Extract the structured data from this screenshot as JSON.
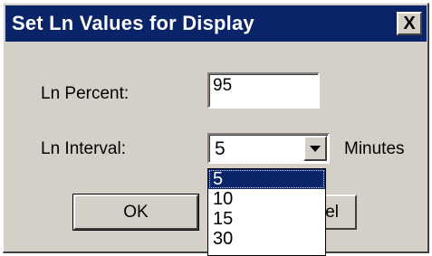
{
  "dialog": {
    "title": "Set Ln Values for Display",
    "close_label": "X"
  },
  "form": {
    "ln_percent_label": "Ln Percent:",
    "ln_percent_value": "95",
    "ln_interval_label": "Ln Interval:",
    "ln_interval_value": "5",
    "interval_unit": "Minutes"
  },
  "buttons": {
    "ok_label": "OK",
    "cancel_label_visible": "el"
  },
  "dropdown": {
    "options": [
      "5",
      "10",
      "15",
      "30"
    ],
    "selected": "5"
  },
  "colors": {
    "titlebar": "#0a246a",
    "dialog_face": "#d4d0c8",
    "selection": "#0a246a"
  }
}
